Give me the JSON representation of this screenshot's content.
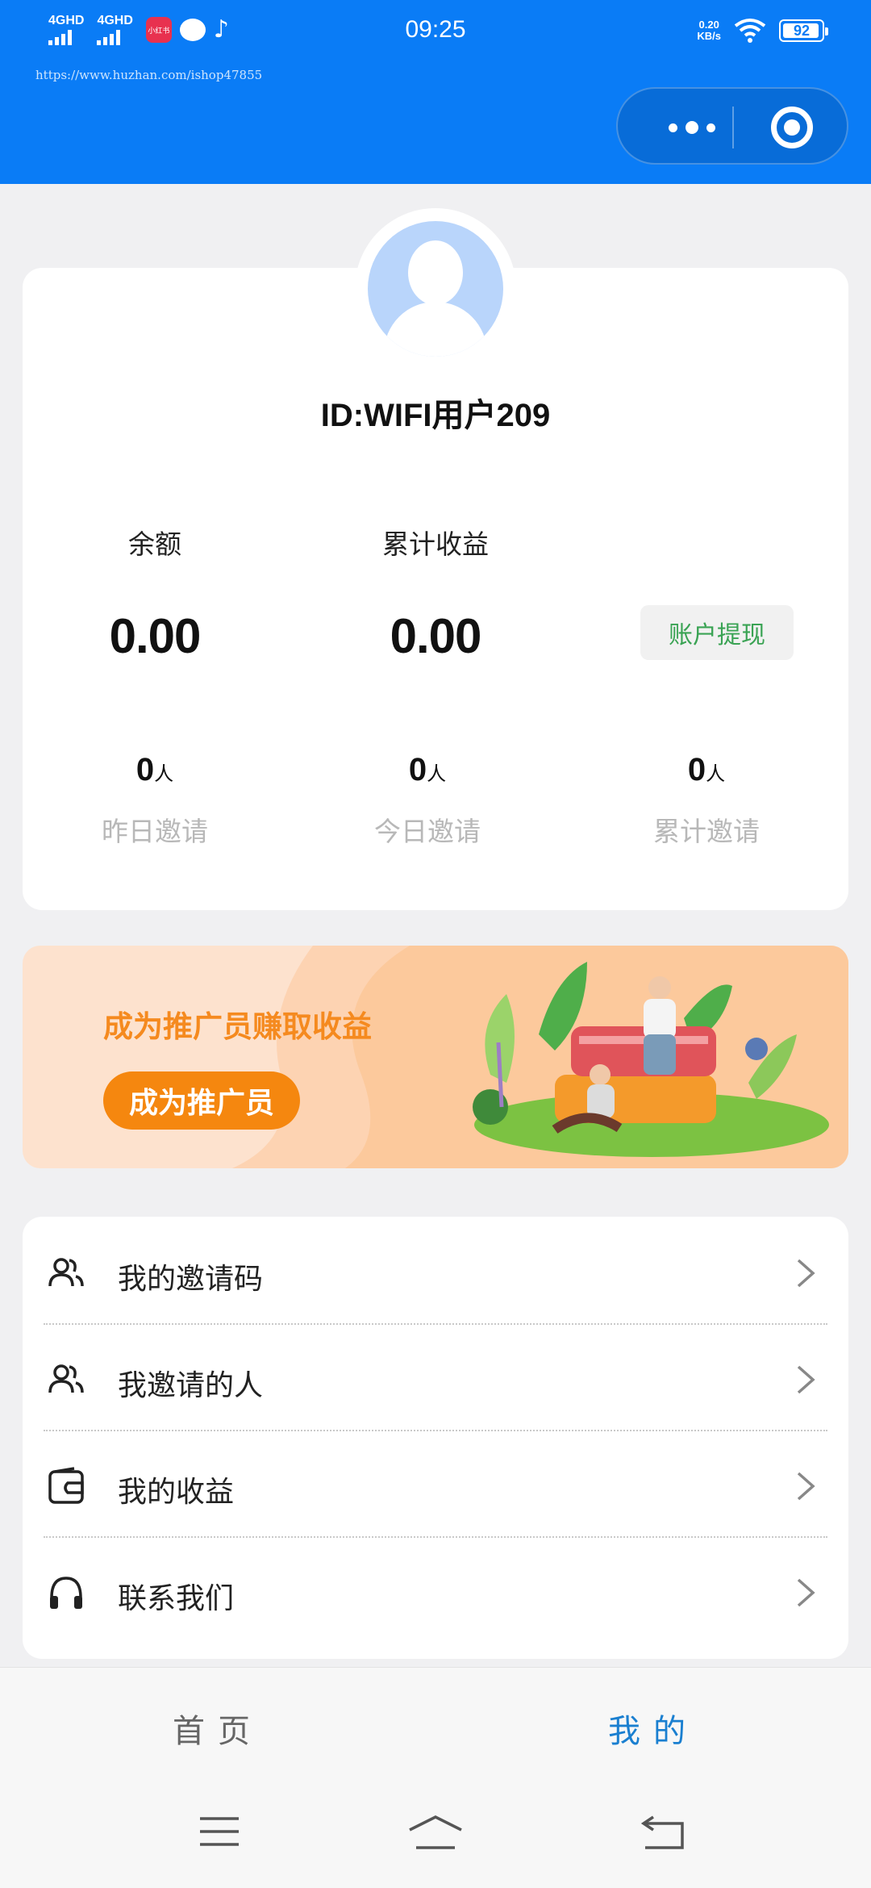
{
  "status_bar": {
    "signal1": "4GHD",
    "signal2": "4GHD",
    "app_icon_text": "小红书",
    "time": "09:25",
    "net_speed_value": "0.20",
    "net_speed_unit": "KB/s",
    "battery": "92"
  },
  "watermark": "https://www.huzhan.com/ishop47855",
  "profile": {
    "user_id": "ID:WIFI用户209",
    "balance_label": "余额",
    "balance_value": "0.00",
    "earnings_label": "累计收益",
    "earnings_value": "0.00",
    "withdraw_label": "账户提现",
    "invites": [
      {
        "count": "0",
        "unit": "人",
        "label": "昨日邀请"
      },
      {
        "count": "0",
        "unit": "人",
        "label": "今日邀请"
      },
      {
        "count": "0",
        "unit": "人",
        "label": "累计邀请"
      }
    ]
  },
  "banner": {
    "title": "成为推广员赚取收益",
    "button": "成为推广员"
  },
  "menu": [
    {
      "label": "我的邀请码",
      "icon": "users-icon"
    },
    {
      "label": "我邀请的人",
      "icon": "users-icon"
    },
    {
      "label": "我的收益",
      "icon": "wallet-icon"
    },
    {
      "label": "联系我们",
      "icon": "headphones-icon"
    }
  ],
  "tabbar": {
    "home": "首页",
    "mine": "我的"
  },
  "colors": {
    "header_blue": "#0a7cf6",
    "banner_orange": "#f5870f",
    "withdraw_green": "#3aa354",
    "active_tab": "#1a7fd0"
  }
}
